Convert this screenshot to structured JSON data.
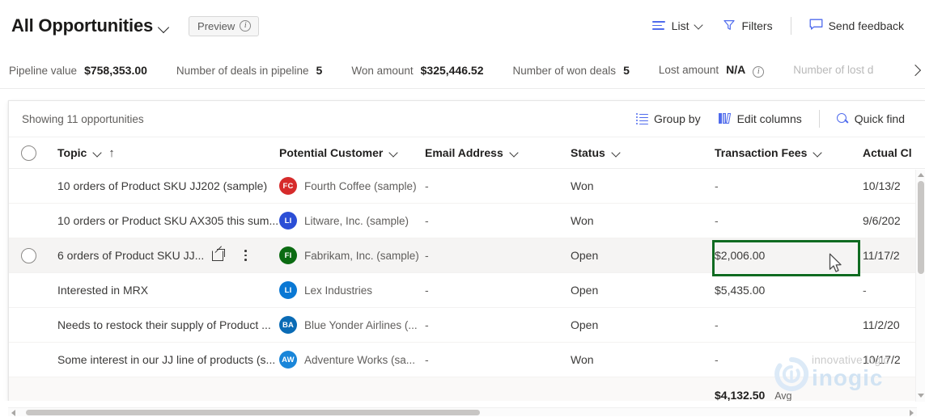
{
  "header": {
    "title": "All Opportunities",
    "title_chevron_icon": "chevron-down-icon",
    "preview_label": "Preview",
    "preview_info_icon": "info-icon",
    "actions": [
      {
        "label": "List",
        "icon": "list-icon",
        "has_chevron": true
      },
      {
        "label": "Filters",
        "icon": "filter-icon",
        "has_chevron": false
      },
      {
        "label": "Send feedback",
        "icon": "feedback-comment-icon",
        "has_chevron": false
      }
    ]
  },
  "kpis": [
    {
      "label": "Pipeline value",
      "value": "$758,353.00",
      "info": false,
      "faded": false
    },
    {
      "label": "Number of deals in pipeline",
      "value": "5",
      "info": false,
      "faded": false
    },
    {
      "label": "Won amount",
      "value": "$325,446.52",
      "info": false,
      "faded": false
    },
    {
      "label": "Number of won deals",
      "value": "5",
      "info": false,
      "faded": false
    },
    {
      "label": "Lost amount",
      "value": "N/A",
      "info": true,
      "faded": false
    },
    {
      "label": "Number of lost d",
      "value": "",
      "info": false,
      "faded": true
    }
  ],
  "commandbar": {
    "showing": "Showing 11 opportunities",
    "group_by_label": "Group by",
    "edit_columns_label": "Edit columns",
    "quick_find_label": "Quick find"
  },
  "table": {
    "columns": [
      {
        "label": "Topic",
        "caret": true,
        "sorted_asc": true
      },
      {
        "label": "Potential Customer",
        "caret": true,
        "sorted_asc": false
      },
      {
        "label": "Email Address",
        "caret": true,
        "sorted_asc": false
      },
      {
        "label": "Status",
        "caret": true,
        "sorted_asc": false
      },
      {
        "label": "Transaction Fees",
        "caret": true,
        "sorted_asc": false
      },
      {
        "label": "Actual Cl",
        "caret": false,
        "sorted_asc": false
      }
    ],
    "rows": [
      {
        "topic": "10 orders of Product SKU JJ202 (sample)",
        "customer": "Fourth Coffee (sample)",
        "initials": "FC",
        "avatar_color": "#d62b2b",
        "email": "-",
        "status": "Won",
        "fees": "-",
        "close_date": "10/13/2",
        "hovered": false
      },
      {
        "topic": "10 orders or Product SKU AX305 this sum...",
        "customer": "Litware, Inc. (sample)",
        "initials": "LI",
        "avatar_color": "#2b4ed6",
        "email": "-",
        "status": "Won",
        "fees": "-",
        "close_date": "9/6/202",
        "hovered": false
      },
      {
        "topic": "6 orders of Product SKU JJ...",
        "customer": "Fabrikam, Inc. (sample)",
        "initials": "FI",
        "avatar_color": "#0b6b12",
        "email": "-",
        "status": "Open",
        "fees": "$2,006.00",
        "close_date": "11/17/2",
        "hovered": true
      },
      {
        "topic": "Interested in MRX",
        "customer": "Lex Industries",
        "initials": "LI",
        "avatar_color": "#0a78d4",
        "email": "-",
        "status": "Open",
        "fees": "$5,435.00",
        "close_date": "-",
        "hovered": false
      },
      {
        "topic": "Needs to restock their supply of Product ...",
        "customer": "Blue Yonder Airlines (...",
        "initials": "BA",
        "avatar_color": "#0a6bb5",
        "email": "-",
        "status": "Open",
        "fees": "-",
        "close_date": "11/2/20",
        "hovered": false
      },
      {
        "topic": "Some interest in our JJ line of products (s...",
        "customer": "Adventure Works (sa...",
        "initials": "AW",
        "avatar_color": "#1a86d9",
        "email": "-",
        "status": "Won",
        "fees": "-",
        "close_date": "10/17/2",
        "hovered": false
      }
    ],
    "aggregate": {
      "value": "$4,132.50",
      "label": "Avg"
    },
    "row_actions": {
      "open_record_icon": "open-in-new-icon",
      "more_commands_icon": "more-vertical-icon"
    }
  },
  "highlight": {
    "target_cell_value": "$2,006.00",
    "color": "#106b21"
  },
  "watermark": {
    "tagline": "innovative logic",
    "wordmark": "inogic"
  },
  "colors": {
    "accent": "#4f6bed",
    "highlight_green": "#106b21",
    "hover_row": "#f5f4f3",
    "watermark_blue": "#cfe2f3"
  }
}
